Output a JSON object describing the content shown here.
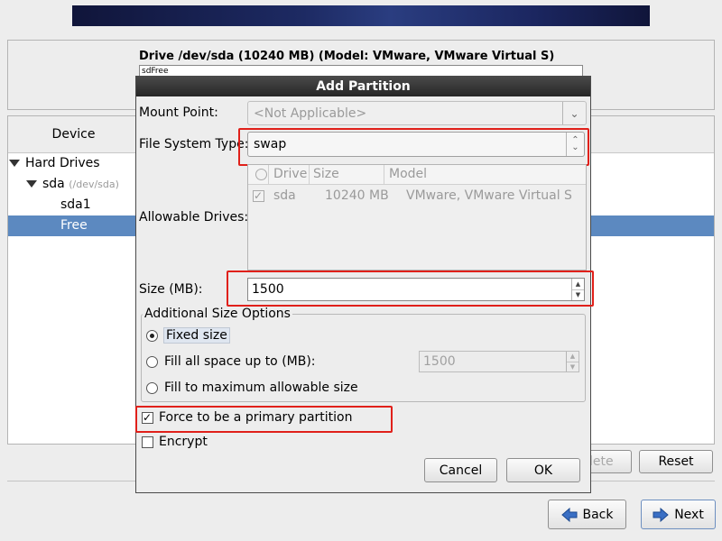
{
  "main": {
    "drive_title": "Drive /dev/sda (10240 MB) (Model: VMware, VMware Virtual S)",
    "drive_map_label": "sdFree",
    "tree": {
      "header": "Device",
      "hard_drives_label": "Hard Drives",
      "sda_label": "sda",
      "sda_path": "(/dev/sda)",
      "sda1_label": "sda1",
      "free_label": "Free"
    },
    "buttons": {
      "delete_label": "lete",
      "reset_label": "Reset",
      "back_label": "Back",
      "next_label": "Next"
    }
  },
  "dialog": {
    "title": "Add Partition",
    "mount_point": {
      "label": "Mount Point:",
      "value": "<Not Applicable>"
    },
    "fs_type": {
      "label": "File System Type:",
      "value": "swap"
    },
    "drives": {
      "label": "Allowable Drives:",
      "columns": [
        "Drive",
        "Size",
        "Model"
      ],
      "rows": [
        {
          "drive": "sda",
          "size": "10240 MB",
          "model": "VMware, VMware Virtual S"
        }
      ]
    },
    "size": {
      "label": "Size (MB):",
      "value": "1500"
    },
    "additional": {
      "legend": "Additional Size Options",
      "fixed_label": "Fixed size",
      "fill_upto_label": "Fill all space up to (MB):",
      "fill_upto_value": "1500",
      "fill_max_label": "Fill to maximum allowable size"
    },
    "force_primary_label": "Force to be a primary partition",
    "encrypt_label": "Encrypt",
    "cancel_label": "Cancel",
    "ok_label": "OK"
  },
  "colors": {
    "highlight": "#e0201a",
    "selection": "#5c89c0",
    "dialog_title_bg": "#262626"
  }
}
